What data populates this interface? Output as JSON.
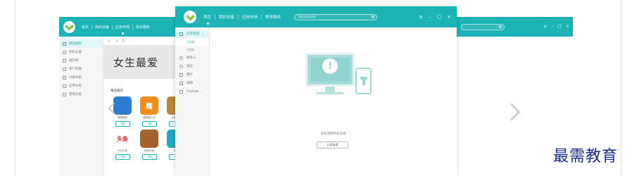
{
  "colors": {
    "titlebar": "#1bb3b4",
    "accent": "#1bb3b4",
    "watermark": "#1a2f8f"
  },
  "back_window": {
    "nav": [
      "首页",
      "我的设备",
      "应用市场",
      "更多服务"
    ],
    "active_nav": "应用市场",
    "sidebar": [
      "精品推荐",
      "装机必备",
      "排行榜",
      "热门专题",
      "分类导航",
      "应用分类",
      "游戏分类"
    ],
    "banner_text": "女生最爱",
    "section_title": "精品推荐",
    "apps": [
      {
        "name": "美图秀秀",
        "icon": "app-icon-blue",
        "color": "#2a7fd4",
        "glyph": "",
        "button": "下载"
      },
      {
        "name": "搜狗输入法",
        "icon": "app-icon-orange",
        "color": "#f08c1c",
        "glyph": "糯",
        "button": "下载"
      },
      {
        "name": "斗鱼直播",
        "icon": "app-icon-game",
        "color": "#b5863a",
        "glyph": "",
        "button": "下载"
      },
      {
        "name": "今日头条",
        "icon": "app-icon-red",
        "color": "#ffffff",
        "glyph": "头条",
        "button": "下载"
      },
      {
        "name": "西游无双",
        "icon": "app-icon-monkey",
        "color": "#a4622c",
        "glyph": "",
        "button": "下载"
      },
      {
        "name": "应用",
        "icon": "app-icon-teal",
        "color": "#1fa8c4",
        "glyph": "",
        "button": "下载"
      }
    ]
  },
  "main_window": {
    "nav": [
      "首页",
      "我的设备",
      "应用市场",
      "更多服务"
    ],
    "active_nav": "首页",
    "search_placeholder": "搜索应用或游戏",
    "sidebar": {
      "header": "应用管理",
      "sub_items": [
        "已安装",
        "可更新"
      ],
      "items": [
        "联系人",
        "短信",
        "图片",
        "视频",
        "Outlook"
      ]
    },
    "status_text": "未检测到手机连接",
    "connect_button": "立即连接"
  },
  "watermark": "最需教育"
}
